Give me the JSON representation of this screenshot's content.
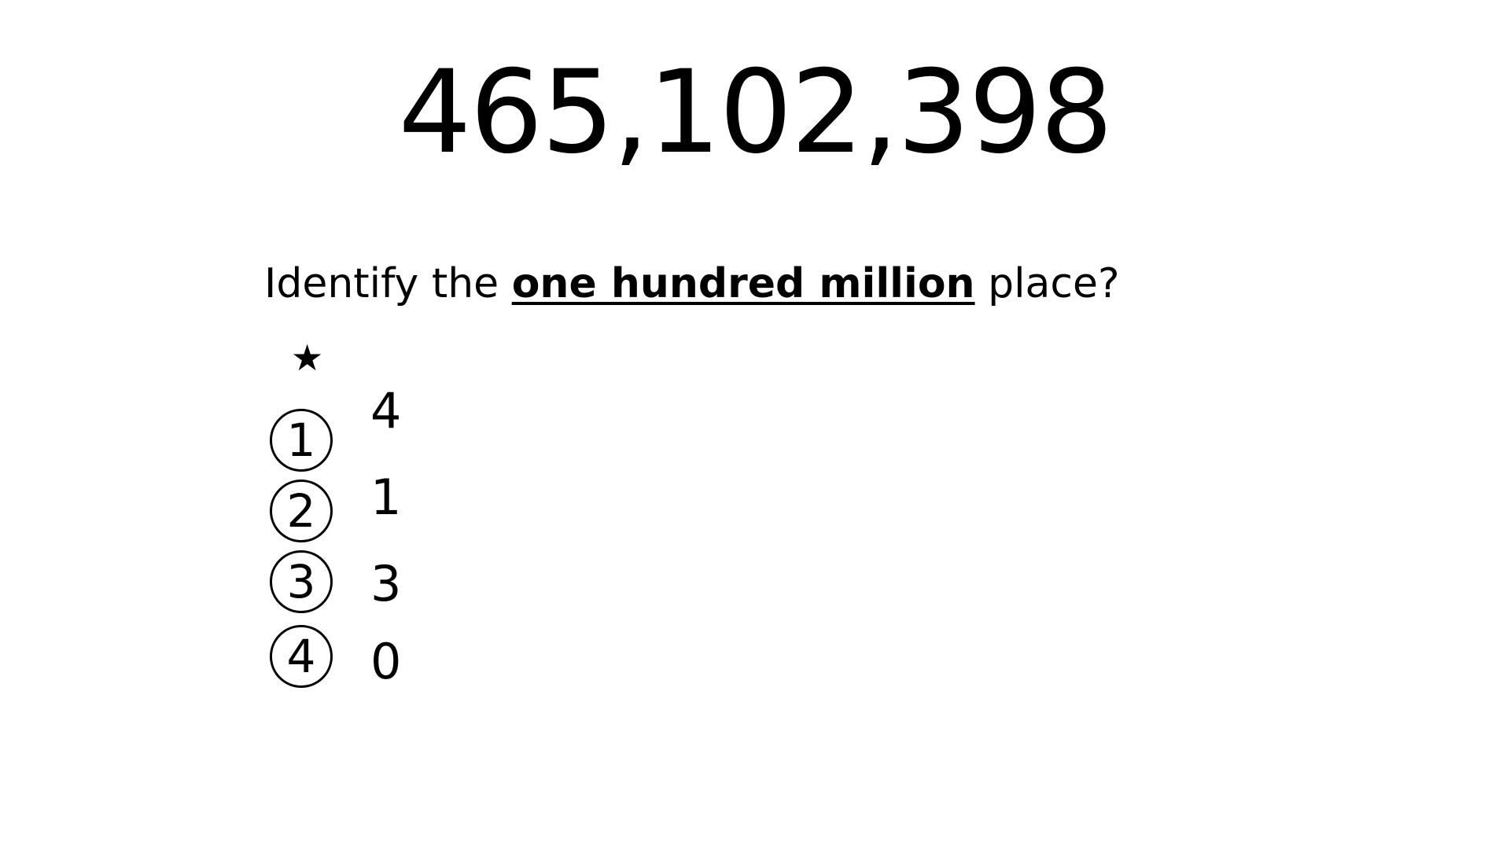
{
  "number": "465,102,398",
  "question": {
    "prefix": "Identify the ",
    "emphasis": "one hundred million",
    "suffix": " place?"
  },
  "marker_icon": "star-icon",
  "options": [
    {
      "marker": "1",
      "value": "4"
    },
    {
      "marker": "2",
      "value": "1"
    },
    {
      "marker": "3",
      "value": "3"
    },
    {
      "marker": "4",
      "value": "0"
    }
  ]
}
